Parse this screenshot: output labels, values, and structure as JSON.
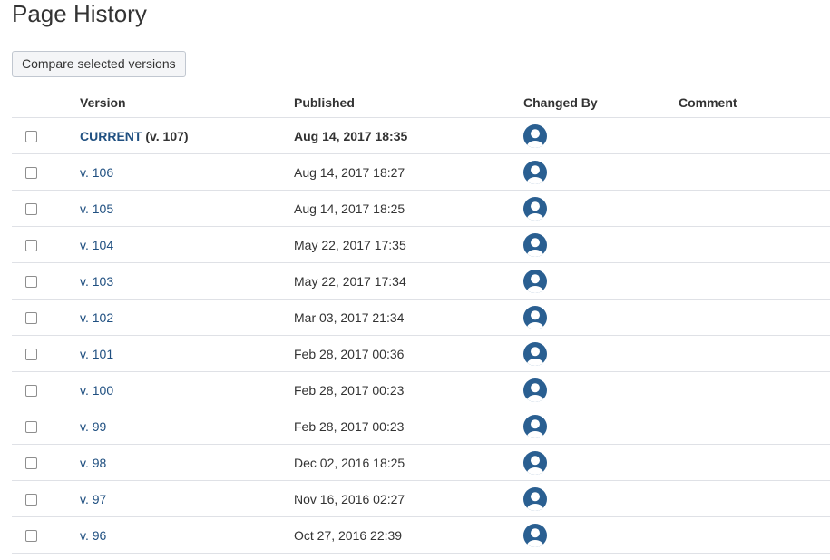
{
  "page": {
    "title": "Page History"
  },
  "toolbar": {
    "compare_label": "Compare selected versions"
  },
  "table": {
    "headers": {
      "version": "Version",
      "published": "Published",
      "changed_by": "Changed By",
      "comment": "Comment"
    },
    "rows": [
      {
        "version": "CURRENT",
        "suffix": " (v. 107)",
        "published": "Aug 14, 2017 18:35",
        "comment": ""
      },
      {
        "version": "v. 106",
        "suffix": "",
        "published": "Aug 14, 2017 18:27",
        "comment": ""
      },
      {
        "version": "v. 105",
        "suffix": "",
        "published": "Aug 14, 2017 18:25",
        "comment": ""
      },
      {
        "version": "v. 104",
        "suffix": "",
        "published": "May 22, 2017 17:35",
        "comment": ""
      },
      {
        "version": "v. 103",
        "suffix": "",
        "published": "May 22, 2017 17:34",
        "comment": ""
      },
      {
        "version": "v. 102",
        "suffix": "",
        "published": "Mar 03, 2017 21:34",
        "comment": ""
      },
      {
        "version": "v. 101",
        "suffix": "",
        "published": "Feb 28, 2017 00:36",
        "comment": ""
      },
      {
        "version": "v. 100",
        "suffix": "",
        "published": "Feb 28, 2017 00:23",
        "comment": ""
      },
      {
        "version": "v. 99",
        "suffix": "",
        "published": "Feb 28, 2017 00:23",
        "comment": ""
      },
      {
        "version": "v. 98",
        "suffix": "",
        "published": "Dec 02, 2016 18:25",
        "comment": ""
      },
      {
        "version": "v. 97",
        "suffix": "",
        "published": "Nov 16, 2016 02:27",
        "comment": ""
      },
      {
        "version": "v. 96",
        "suffix": "",
        "published": "Oct 27, 2016 22:39",
        "comment": ""
      }
    ]
  },
  "colors": {
    "link": "#205081",
    "avatar": "#2a5f91"
  },
  "icons": {
    "avatar": "user-avatar-icon",
    "checkbox": "checkbox"
  }
}
